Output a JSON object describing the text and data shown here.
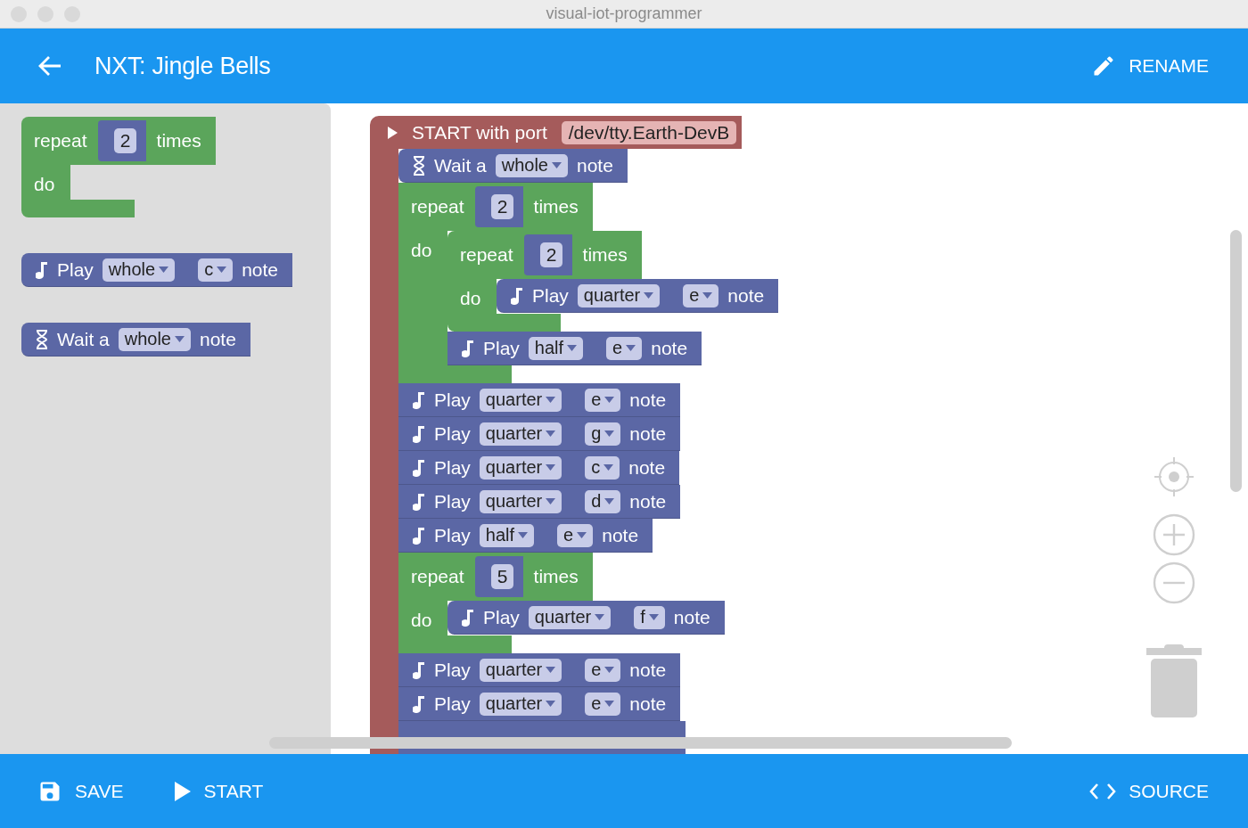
{
  "window": {
    "title": "visual-iot-programmer"
  },
  "app_bar": {
    "title": "NXT: Jingle Bells",
    "action": "RENAME"
  },
  "toolbox": {
    "blocks": [
      {
        "kind": "repeat",
        "label": "repeat",
        "count": "2",
        "times": "times",
        "do": "do"
      },
      {
        "kind": "play",
        "label": "Play",
        "duration": "whole",
        "pitch": "c",
        "suffix": "note"
      },
      {
        "kind": "wait",
        "label": "Wait a",
        "duration": "whole",
        "suffix": "note"
      }
    ]
  },
  "program": {
    "label": "START with port",
    "port": "/dev/tty.Earth-DevB",
    "children": [
      {
        "kind": "wait",
        "label": "Wait a",
        "duration": "whole",
        "suffix": "note"
      },
      {
        "kind": "repeat",
        "label": "repeat",
        "count": "2",
        "times": "times",
        "do": "do",
        "children": [
          {
            "kind": "repeat",
            "label": "repeat",
            "count": "2",
            "times": "times",
            "do": "do",
            "children": [
              {
                "kind": "play",
                "label": "Play",
                "duration": "quarter",
                "pitch": "e",
                "suffix": "note"
              }
            ]
          },
          {
            "kind": "play",
            "label": "Play",
            "duration": "half",
            "pitch": "e",
            "suffix": "note"
          }
        ]
      },
      {
        "kind": "play",
        "label": "Play",
        "duration": "quarter",
        "pitch": "e",
        "suffix": "note"
      },
      {
        "kind": "play",
        "label": "Play",
        "duration": "quarter",
        "pitch": "g",
        "suffix": "note"
      },
      {
        "kind": "play",
        "label": "Play",
        "duration": "quarter",
        "pitch": "c",
        "suffix": "note"
      },
      {
        "kind": "play",
        "label": "Play",
        "duration": "quarter",
        "pitch": "d",
        "suffix": "note"
      },
      {
        "kind": "play",
        "label": "Play",
        "duration": "half",
        "pitch": "e",
        "suffix": "note"
      },
      {
        "kind": "repeat",
        "label": "repeat",
        "count": "5",
        "times": "times",
        "do": "do",
        "children": [
          {
            "kind": "play",
            "label": "Play",
            "duration": "quarter",
            "pitch": "f",
            "suffix": "note"
          }
        ]
      },
      {
        "kind": "play",
        "label": "Play",
        "duration": "quarter",
        "pitch": "e",
        "suffix": "note"
      },
      {
        "kind": "play",
        "label": "Play",
        "duration": "quarter",
        "pitch": "e",
        "suffix": "note"
      },
      {
        "kind": "hidden"
      }
    ]
  },
  "bottom_bar": {
    "buttons": [
      {
        "kind": "save",
        "label": "SAVE"
      },
      {
        "kind": "start",
        "label": "START"
      },
      {
        "kind": "source",
        "label": "SOURCE"
      }
    ]
  }
}
